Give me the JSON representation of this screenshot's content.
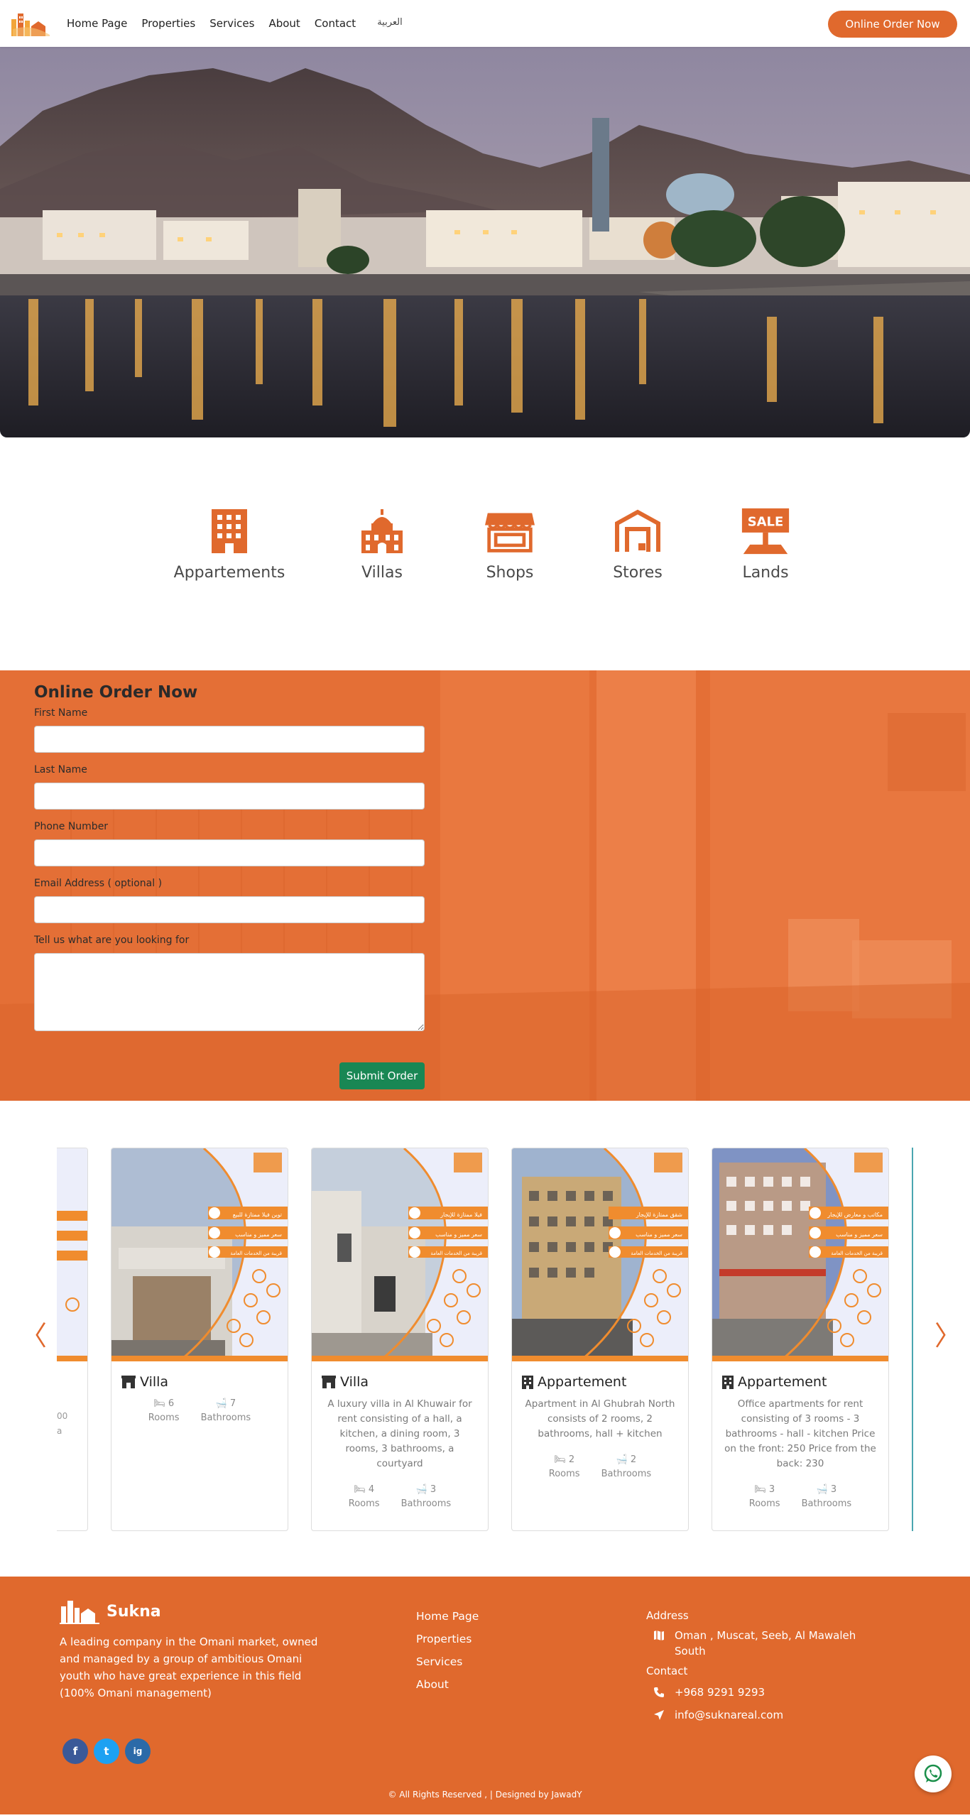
{
  "nav": {
    "links": [
      "Home Page",
      "Properties",
      "Services",
      "About",
      "Contact"
    ],
    "lang": "العربية",
    "cta": "Online Order Now"
  },
  "categories": [
    {
      "label": "Appartements",
      "icon": "building-icon"
    },
    {
      "label": "Villas",
      "icon": "villa-icon"
    },
    {
      "label": "Shops",
      "icon": "shop-icon"
    },
    {
      "label": "Stores",
      "icon": "warehouse-icon"
    },
    {
      "label": "Lands",
      "icon": "sale-sign-icon",
      "sign_text": "SALE"
    }
  ],
  "order": {
    "title": "Online Order Now",
    "fields": {
      "first_name": "First Name",
      "last_name": "Last Name",
      "phone": "Phone Number",
      "email": "Email Address ( optional )",
      "message": "Tell us what are you looking for"
    },
    "submit": "Submit Order"
  },
  "listings": {
    "prev_arrow": "〈",
    "next_arrow": "〉",
    "partial_left": {
      "lines": [
        "00",
        "a"
      ]
    },
    "cards": [
      {
        "type": "Villa",
        "icon": "villa-icon",
        "description": "",
        "rooms": "6",
        "bathrooms": "7",
        "rooms_label": "Rooms",
        "bathrooms_label": "Bathrooms"
      },
      {
        "type": "Villa",
        "icon": "villa-icon",
        "description": "A luxury villa in Al Khuwair for rent consisting of a hall, a kitchen, a dining room, 3 rooms, 3 bathrooms, a courtyard",
        "rooms": "4",
        "bathrooms": "3",
        "rooms_label": "Rooms",
        "bathrooms_label": "Bathrooms"
      },
      {
        "type": "Appartement",
        "icon": "building-icon",
        "description": "Apartment in Al Ghubrah North consists of 2 rooms, 2 bathrooms, hall + kitchen",
        "rooms": "2",
        "bathrooms": "2",
        "rooms_label": "Rooms",
        "bathrooms_label": "Bathrooms"
      },
      {
        "type": "Appartement",
        "icon": "building-icon",
        "description": "Office apartments for rent consisting of 3 rooms - 3 bathrooms - hall - kitchen Price on the front: 250 Price from the back: 230",
        "rooms": "3",
        "bathrooms": "3",
        "rooms_label": "Rooms",
        "bathrooms_label": "Bathrooms"
      }
    ],
    "flyer_banners": [
      [
        "توين فيلا ممتازة للبيع",
        "سعر مميز و مناسب",
        "قريبة من الخدمات العامة"
      ],
      [
        "فيلا ممتازة للإيجار",
        "سعر مميز و مناسب",
        "قريبة من الخدمات العامة"
      ],
      [
        "شقق ممتازة للإيجار",
        "سعر مميز و مناسب",
        "قريبة من الخدمات العامة"
      ],
      [
        "مكاتب و معارض للإيجار",
        "سعر مميز و مناسب",
        "قريبة من الخدمات العامة"
      ]
    ]
  },
  "footer": {
    "brand": "Sukna",
    "about": "A leading company in the Omani market, owned and managed by a group of ambitious Omani youth who have great experience in this field (100% Omani management)",
    "links": [
      "Home Page",
      "Properties",
      "Services",
      "About"
    ],
    "address_title": "Address",
    "address": "Oman , Muscat, Seeb, Al Mawaleh South",
    "contact_title": "Contact",
    "phone": "+968 9291 9293",
    "email": "info@suknareal.com",
    "social": [
      "f",
      "t",
      "ig"
    ],
    "copyright": "© All Rights Reserved , | Designed by JawadY"
  },
  "colors": {
    "brand": "#e0692d",
    "submit": "#198754",
    "facebook": "#3b5998",
    "twitter": "#1da1f2",
    "instagram": "#2b6aa8"
  }
}
